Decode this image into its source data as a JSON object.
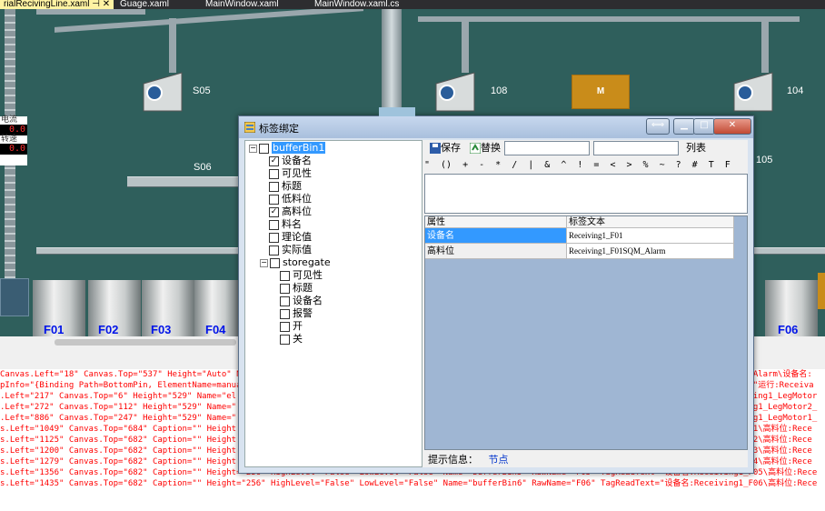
{
  "editor_tabs": [
    "rialRecivingLine.xaml",
    "Guage.xaml",
    "MainWindow.xaml",
    "MainWindow.xaml.cs"
  ],
  "pin_icons": "⊣ ✕",
  "canvas": {
    "machine_labels": [
      "S05",
      "108",
      "104",
      "S06",
      "105"
    ],
    "motor_label": "M",
    "bin_labels": [
      "F01",
      "F02",
      "F03",
      "F04",
      "F06"
    ],
    "side_panel": {
      "label1": "电流",
      "value1": "0.0",
      "label2": "转速",
      "value2": "0.0"
    }
  },
  "xaml_lines": [
    "Canvas.Left=\"18\" Canvas.Top=\"537\" Height=\"Auto\" N",
    "pInfo=\"{Binding Path=BottomPin, ElementName=manua",
    ".Left=\"217\" Canvas.Top=\"6\" Height=\"529\" Name=\"el",
    ".Left=\"272\" Canvas.Top=\"112\" Height=\"529\" Name=\"",
    ".Left=\"886\" Canvas.Top=\"247\" Height=\"529\" Name=\"",
    "s.Left=\"1049\" Canvas.Top=\"684\" Caption=\"\" Height",
    "s.Left=\"1125\" Canvas.Top=\"682\" Caption=\"\" Height",
    "s.Left=\"1200\" Canvas.Top=\"682\" Caption=\"\" Height",
    "s.Left=\"1279\" Canvas.Top=\"682\" Caption=\"\" Height",
    "s.Left=\"1356\" Canvas.Top=\"682\" Caption=\"\" Height=\"256\" HighLevel=\"False\" LowLevel=\"False\" Name=\"bufferBin5\" RawName=\"F05\" TagReadText=\"设备名:Receiving1_F05\\高料位:Rece",
    "s.Left=\"1435\" Canvas.Top=\"682\" Caption=\"\" Height=\"256\" HighLevel=\"False\" LowLevel=\"False\" Name=\"bufferBin6\" RawName=\"F06\" TagReadText=\"设备名:Receiving1_F06\\高料位:Rece"
  ],
  "xaml_right": [
    "5_Alarm\\设备名:",
    "t=\"运行:Receiva",
    "iving1_LegMotor",
    "ing1_LegMotor2_",
    "ing1_LegMotor1_",
    "F01\\高料位:Rece",
    "F02\\高料位:Rece",
    "F03\\高料位:Rece",
    "F04\\高料位:Rece"
  ],
  "dialog": {
    "title": "标签绑定",
    "restore_btn": "⟺",
    "min_btn": "▁",
    "max_btn": "□",
    "close_btn": "✕",
    "tree": {
      "root": "bufferBin1",
      "root_children": [
        {
          "label": "设备名",
          "checked": true
        },
        {
          "label": "可见性",
          "checked": false
        },
        {
          "label": "标题",
          "checked": false
        },
        {
          "label": "低料位",
          "checked": false
        },
        {
          "label": "高料位",
          "checked": true
        },
        {
          "label": "料名",
          "checked": false
        },
        {
          "label": "理论值",
          "checked": false
        },
        {
          "label": "实际值",
          "checked": false
        }
      ],
      "group": "storegate",
      "group_children": [
        {
          "label": "可见性",
          "checked": false
        },
        {
          "label": "标题",
          "checked": false
        },
        {
          "label": "设备名",
          "checked": false
        },
        {
          "label": "报警",
          "checked": false
        },
        {
          "label": "开",
          "checked": false
        },
        {
          "label": "关",
          "checked": false
        }
      ]
    },
    "toolbar": {
      "save": "保存",
      "replace": "替换",
      "field1": "",
      "field2": "",
      "list": "列表"
    },
    "symbols": "\" () + - * / | & ^ ! = < > % ~ ? # T F",
    "grid": {
      "headers": [
        "属性",
        "标签文本"
      ],
      "rows": [
        {
          "prop": "设备名",
          "text": "Receiving1_F01",
          "selected": true
        },
        {
          "prop": "高料位",
          "text": "Receiving1_F01SQM_Alarm",
          "selected": false
        }
      ]
    },
    "status": {
      "label": "提示信息：",
      "value": "节点"
    }
  }
}
